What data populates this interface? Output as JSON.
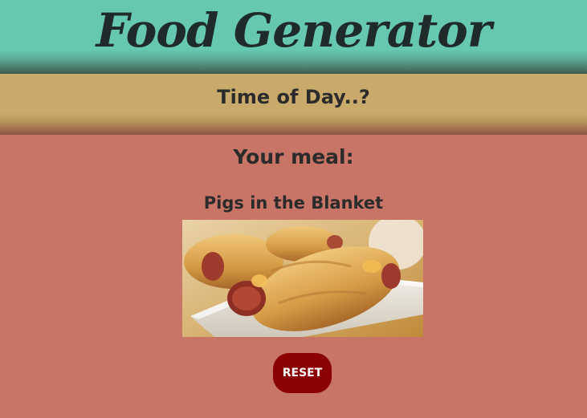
{
  "header": {
    "title": "Food Generator"
  },
  "time_band": {
    "label": "Time of Day..?"
  },
  "meal": {
    "heading": "Your meal:",
    "name": "Pigs in the Blanket",
    "image_alt": "Pigs in the Blanket"
  },
  "actions": {
    "reset_label": "RESET"
  },
  "colors": {
    "header_bg": "#67c8b2",
    "time_band_bg": "#c9aa6a",
    "page_bg": "#c87466",
    "reset_button_bg": "#8b0000"
  }
}
